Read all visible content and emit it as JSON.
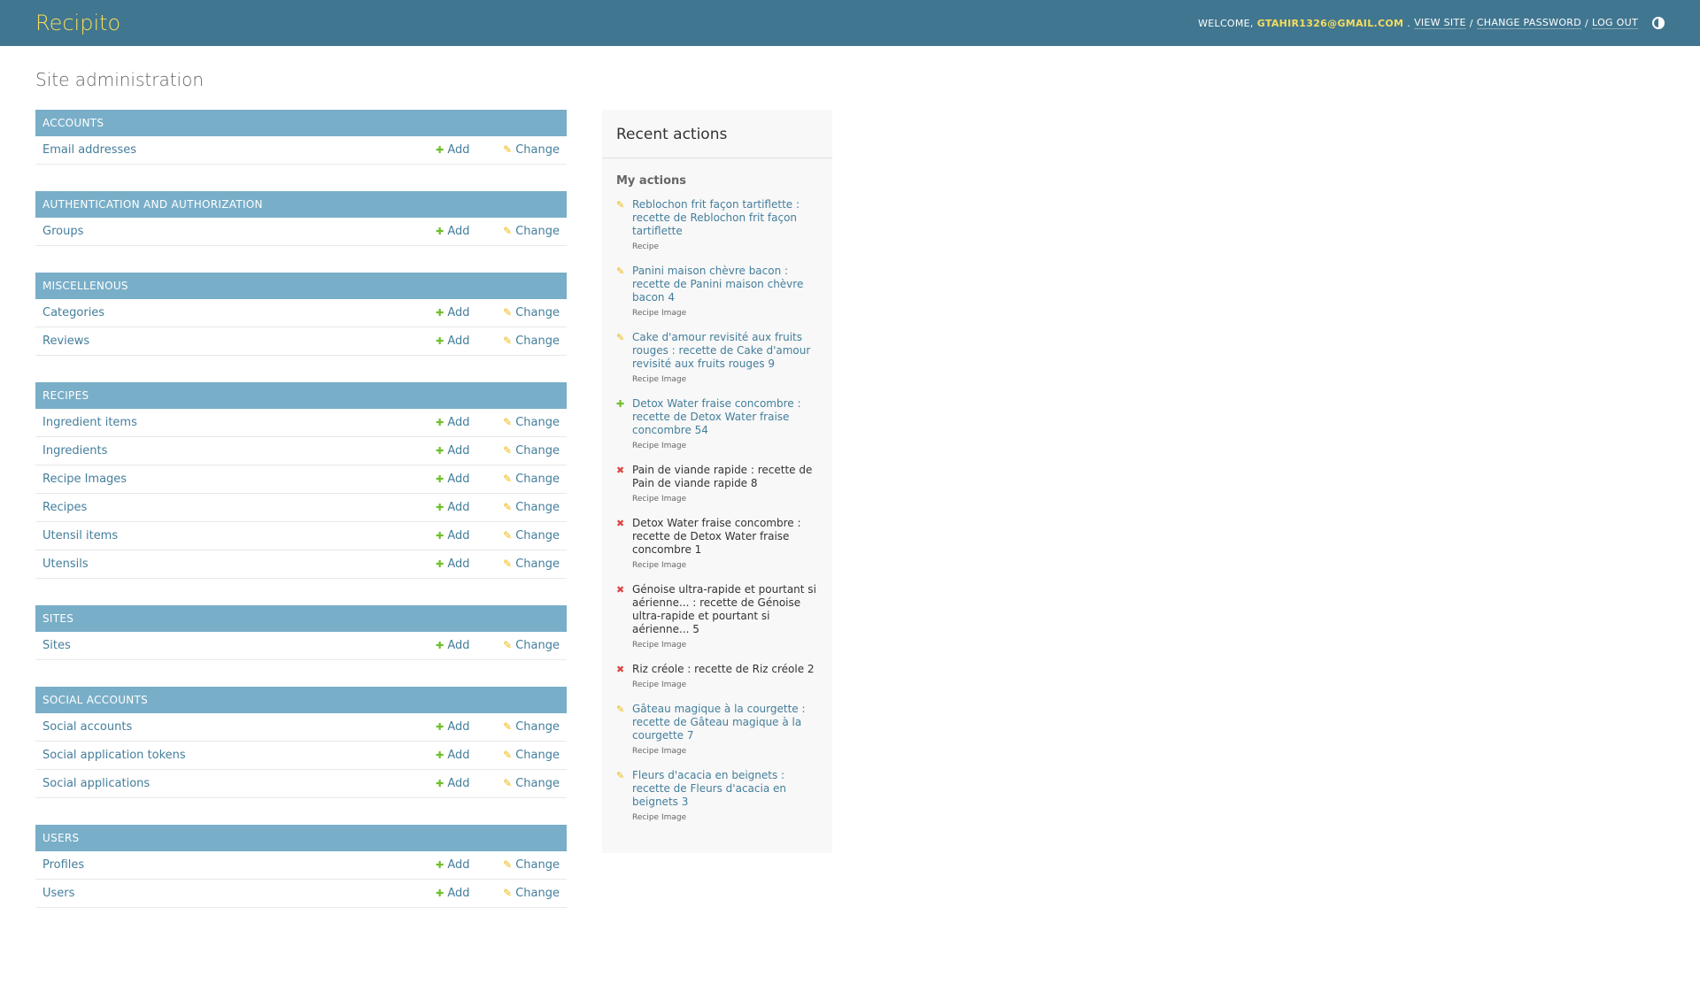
{
  "header": {
    "brand": "Recipito",
    "welcome": "WELCOME,",
    "user": "GTAHIR1326@GMAIL.COM",
    "view_site": "VIEW SITE",
    "change_password": "CHANGE PASSWORD",
    "log_out": "LOG OUT"
  },
  "page_title": "Site administration",
  "labels": {
    "add": "Add",
    "change": "Change"
  },
  "modules": [
    {
      "caption": "ACCOUNTS",
      "models": [
        {
          "name": "Email addresses"
        }
      ]
    },
    {
      "caption": "AUTHENTICATION AND AUTHORIZATION",
      "models": [
        {
          "name": "Groups"
        }
      ]
    },
    {
      "caption": "MISCELLENOUS",
      "models": [
        {
          "name": "Categories"
        },
        {
          "name": "Reviews"
        }
      ]
    },
    {
      "caption": "RECIPES",
      "models": [
        {
          "name": "Ingredient items"
        },
        {
          "name": "Ingredients"
        },
        {
          "name": "Recipe Images"
        },
        {
          "name": "Recipes"
        },
        {
          "name": "Utensil items"
        },
        {
          "name": "Utensils"
        }
      ]
    },
    {
      "caption": "SITES",
      "models": [
        {
          "name": "Sites"
        }
      ]
    },
    {
      "caption": "SOCIAL ACCOUNTS",
      "models": [
        {
          "name": "Social accounts"
        },
        {
          "name": "Social application tokens"
        },
        {
          "name": "Social applications"
        }
      ]
    },
    {
      "caption": "USERS",
      "models": [
        {
          "name": "Profiles"
        },
        {
          "name": "Users"
        }
      ]
    }
  ],
  "recent": {
    "title": "Recent actions",
    "subtitle": "My actions",
    "items": [
      {
        "action": "change",
        "text": "Reblochon frit façon tartiflette : recette de Reblochon frit façon tartiflette",
        "type": "Recipe"
      },
      {
        "action": "change",
        "text": "Panini maison chèvre bacon : recette de Panini maison chèvre bacon 4",
        "type": "Recipe Image"
      },
      {
        "action": "change",
        "text": "Cake d'amour revisité aux fruits rouges : recette de Cake d'amour revisité aux fruits rouges 9",
        "type": "Recipe Image"
      },
      {
        "action": "add",
        "text": "Detox Water fraise concombre : recette de Detox Water fraise concombre 54",
        "type": "Recipe Image"
      },
      {
        "action": "delete",
        "text": "Pain de viande rapide : recette de Pain de viande rapide 8",
        "type": "Recipe Image"
      },
      {
        "action": "delete",
        "text": "Detox Water fraise concombre : recette de Detox Water fraise concombre 1",
        "type": "Recipe Image"
      },
      {
        "action": "delete",
        "text": "Génoise ultra-rapide et pourtant si aérienne... : recette de Génoise ultra-rapide et pourtant si aérienne... 5",
        "type": "Recipe Image"
      },
      {
        "action": "delete",
        "text": "Riz créole : recette de Riz créole 2",
        "type": "Recipe Image"
      },
      {
        "action": "change",
        "text": "Gâteau magique à la courgette : recette de Gâteau magique à la courgette 7",
        "type": "Recipe Image"
      },
      {
        "action": "change",
        "text": "Fleurs d'acacia en beignets : recette de Fleurs d'acacia en beignets 3",
        "type": "Recipe Image"
      }
    ]
  },
  "colors": {
    "header_bg": "#417690",
    "brand": "#f5dd5d",
    "caption_bg": "#79aec8",
    "link": "#447e9b",
    "add": "#70bf2b",
    "change": "#efb80b",
    "delete": "#dd4646"
  },
  "icons": {
    "add": "plus-icon",
    "change": "pencil-icon",
    "delete": "x-icon",
    "theme": "theme-toggle-icon"
  }
}
